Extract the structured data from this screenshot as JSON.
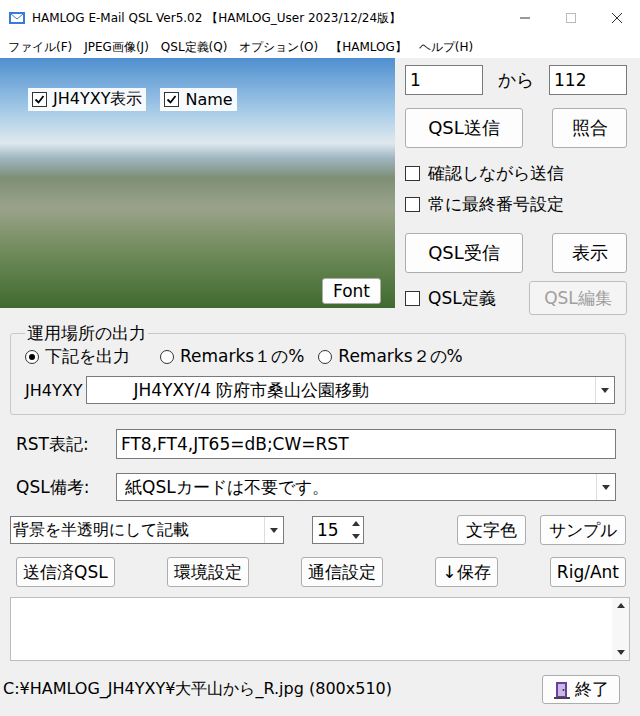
{
  "window": {
    "title": "HAMLOG E-Mail QSL Ver5.02 【HAMLOG_User 2023/12/24版】"
  },
  "menu": [
    "ファイル(F)",
    "JPEG画像(J)",
    "QSL定義(Q)",
    "オプション(O)",
    "【HAMLOG】",
    "ヘルプ(H)"
  ],
  "preview": {
    "checkboxes": [
      {
        "label": "JH4YXY表示",
        "checked": true
      },
      {
        "label": "Name",
        "checked": true
      }
    ],
    "font_button": "Font"
  },
  "range": {
    "from": "1",
    "separator": "から",
    "to": "112"
  },
  "send_buttons": [
    "QSL送信",
    "照合"
  ],
  "send_options": [
    {
      "label": "確認しながら送信",
      "checked": false
    },
    {
      "label": "常に最終番号設定",
      "checked": false
    }
  ],
  "receive_buttons": [
    "QSL受信",
    "表示"
  ],
  "qsl_define": {
    "label": "QSL定義",
    "checked": false
  },
  "qsl_edit": {
    "label": "QSL編集",
    "disabled": true
  },
  "location": {
    "title": "運用場所の出力",
    "radios": [
      {
        "label": "下記を出力",
        "selected": true
      },
      {
        "label": "Remarks１の%",
        "selected": false
      },
      {
        "label": "Remarks２の%",
        "selected": false
      }
    ],
    "call": "JH4YXY",
    "value": "JH4YXY/4 防府市桑山公園移動"
  },
  "rst": {
    "label": "RST表記:",
    "value": "FT8,FT4,JT65=dB;CW=RST"
  },
  "remarks": {
    "label": "QSL備考:",
    "value": "紙QSLカードは不要です。"
  },
  "style_row": {
    "mode": "背景を半透明にして記載",
    "size": "15",
    "buttons": [
      "文字色",
      "サンプル"
    ]
  },
  "tool_buttons": [
    "送信済QSL",
    "環境設定",
    "通信設定",
    "↓保存",
    "Rig/Ant"
  ],
  "log": {
    "text": ""
  },
  "status": {
    "path": "C:¥HAMLOG_JH4YXY¥大平山から_R.jpg (800x510)",
    "exit": "終了"
  }
}
